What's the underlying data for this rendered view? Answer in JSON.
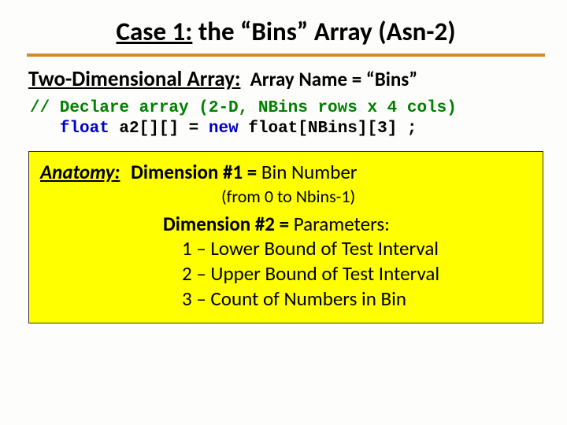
{
  "title": {
    "underlined": "Case 1:",
    "rest": " the “Bins” Array (Asn-2)"
  },
  "section": {
    "heading": "Two-Dimensional Array:",
    "label": "Array Name = “Bins”"
  },
  "code": {
    "comment": "// Declare array (2-D, NBins rows x 4 cols)",
    "indent": "   ",
    "kw1": "float",
    "mid": " a2[][] = ",
    "kw2": "new",
    "tail": " float[NBins][3] ;"
  },
  "anatomy": {
    "heading": "Anatomy:",
    "dim1_label": "Dimension #1 = ",
    "dim1_value": "Bin Number",
    "dim1_sub": "(from 0 to Nbins-1)",
    "dim2_label": "Dimension #2 = ",
    "dim2_value": "Parameters:",
    "params": [
      "1 – Lower Bound of Test Interval",
      "2 – Upper Bound of Test Interval",
      "3 – Count of Numbers in Bin"
    ]
  }
}
